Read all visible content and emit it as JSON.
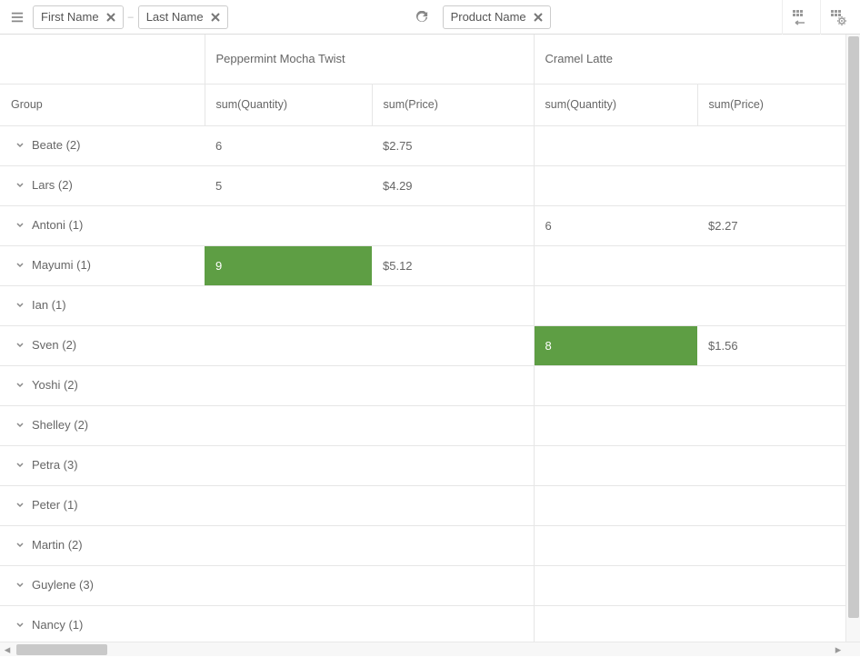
{
  "toolbar": {
    "row_chips": [
      {
        "label": "First Name"
      },
      {
        "label": "Last Name"
      }
    ],
    "col_chips": [
      {
        "label": "Product Name"
      }
    ]
  },
  "header": {
    "group_label": "Group",
    "products": [
      "Peppermint Mocha Twist",
      "Cramel Latte"
    ],
    "measures": [
      "sum(Quantity)",
      "sum(Price)"
    ]
  },
  "rows": [
    {
      "group": "Beate (2)",
      "q1": "6",
      "p1": "$2.75",
      "q2": "",
      "p2": "",
      "hl1": false,
      "hl2": false
    },
    {
      "group": "Lars (2)",
      "q1": "5",
      "p1": "$4.29",
      "q2": "",
      "p2": "",
      "hl1": false,
      "hl2": false
    },
    {
      "group": "Antoni (1)",
      "q1": "",
      "p1": "",
      "q2": "6",
      "p2": "$2.27",
      "hl1": false,
      "hl2": false
    },
    {
      "group": "Mayumi (1)",
      "q1": "9",
      "p1": "$5.12",
      "q2": "",
      "p2": "",
      "hl1": true,
      "hl2": false
    },
    {
      "group": "Ian (1)",
      "q1": "",
      "p1": "",
      "q2": "",
      "p2": "",
      "hl1": false,
      "hl2": false
    },
    {
      "group": "Sven (2)",
      "q1": "",
      "p1": "",
      "q2": "8",
      "p2": "$1.56",
      "hl1": false,
      "hl2": true
    },
    {
      "group": "Yoshi (2)",
      "q1": "",
      "p1": "",
      "q2": "",
      "p2": "",
      "hl1": false,
      "hl2": false
    },
    {
      "group": "Shelley (2)",
      "q1": "",
      "p1": "",
      "q2": "",
      "p2": "",
      "hl1": false,
      "hl2": false
    },
    {
      "group": "Petra (3)",
      "q1": "",
      "p1": "",
      "q2": "",
      "p2": "",
      "hl1": false,
      "hl2": false
    },
    {
      "group": "Peter (1)",
      "q1": "",
      "p1": "",
      "q2": "",
      "p2": "",
      "hl1": false,
      "hl2": false
    },
    {
      "group": "Martin (2)",
      "q1": "",
      "p1": "",
      "q2": "",
      "p2": "",
      "hl1": false,
      "hl2": false
    },
    {
      "group": "Guylene (3)",
      "q1": "",
      "p1": "",
      "q2": "",
      "p2": "",
      "hl1": false,
      "hl2": false
    },
    {
      "group": "Nancy (1)",
      "q1": "",
      "p1": "",
      "q2": "",
      "p2": "",
      "hl1": false,
      "hl2": false
    }
  ]
}
